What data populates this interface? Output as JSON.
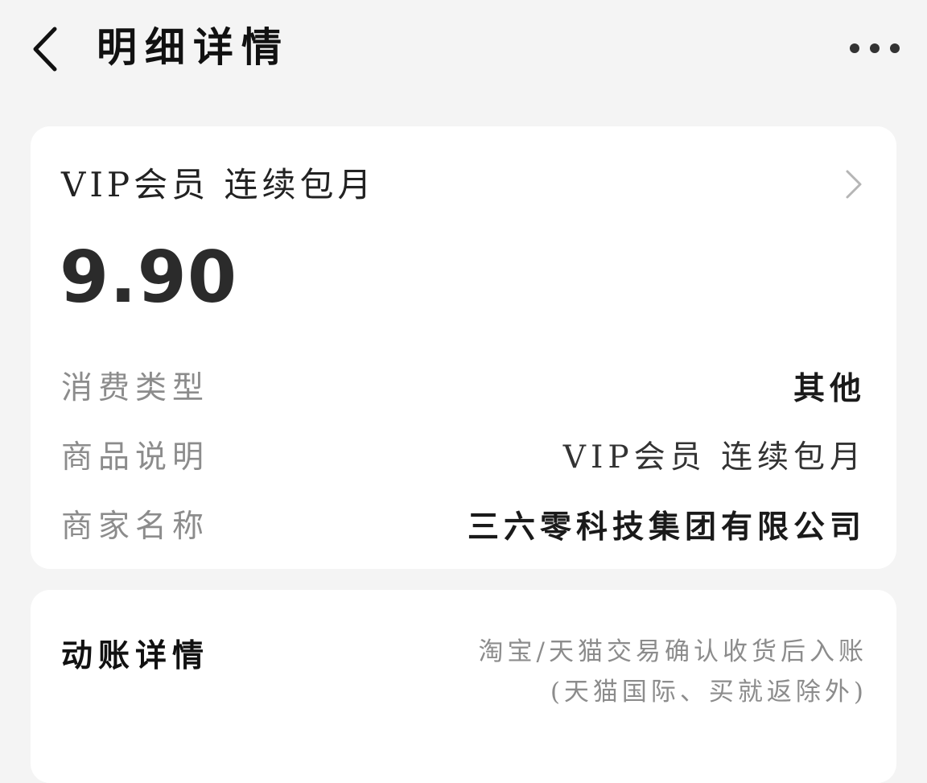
{
  "header": {
    "title": "明细详情",
    "back_icon": "chevron-left-icon",
    "more_icon": "more-horizontal-icon"
  },
  "detail_card": {
    "product_title": "VIP会员  连续包月",
    "chevron_icon": "chevron-right-icon",
    "amount": "9.90",
    "rows": [
      {
        "label": "消费类型",
        "value": "其他"
      },
      {
        "label": "商品说明",
        "value": "VIP会员  连续包月"
      },
      {
        "label": "商家名称",
        "value": "三六零科技集团有限公司"
      }
    ]
  },
  "ledger_card": {
    "label": "动账详情",
    "note_line1": "淘宝/天猫交易确认收货后入账",
    "note_line2": "(天猫国际、买就返除外)"
  },
  "colors": {
    "background": "#f4f4f4",
    "card": "#ffffff",
    "muted_text": "#8c8c8c",
    "primary_text": "#1a1a1a"
  }
}
